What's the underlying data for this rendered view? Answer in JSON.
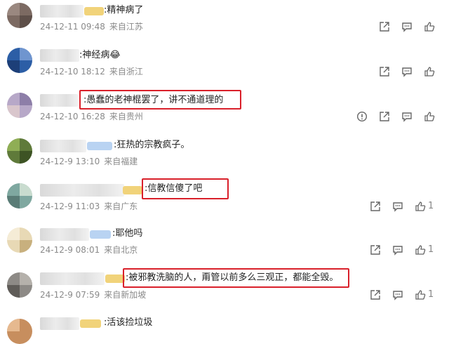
{
  "comments": [
    {
      "text": ":精神病了",
      "date": "24-12-11 09:48",
      "location": "来自江苏",
      "likes": ""
    },
    {
      "text": ":神经病😂",
      "date": "24-12-10 18:12",
      "location": "来自浙江",
      "likes": ""
    },
    {
      "text": ":愚蠢的老神棍罢了，讲不通道理的",
      "date": "24-12-10 16:28",
      "location": "来自贵州",
      "likes": ""
    },
    {
      "text": ":狂热的宗教疯子。",
      "date": "24-12-9 13:10",
      "location": "来自福建",
      "likes": ""
    },
    {
      "text": ":信教信傻了吧",
      "date": "24-12-9 11:03",
      "location": "来自广东",
      "likes": "1"
    },
    {
      "text": ":耶他吗",
      "date": "24-12-9 08:01",
      "location": "来自北京",
      "likes": "1"
    },
    {
      "text": ":被邪教洗脑的人，甭管以前多么三观正，都能全毁。",
      "date": "24-12-9 07:59",
      "location": "来自新加坡",
      "likes": "1"
    },
    {
      "text": ":活该捡垃圾",
      "date": "",
      "location": "",
      "likes": ""
    }
  ],
  "icons": {
    "share": "share-icon",
    "reply": "comment-icon",
    "like": "thumbs-up-icon",
    "report": "report-icon"
  },
  "colors": {
    "highlight": "#d9202a",
    "meta": "#8a8a8a",
    "text": "#222222"
  }
}
